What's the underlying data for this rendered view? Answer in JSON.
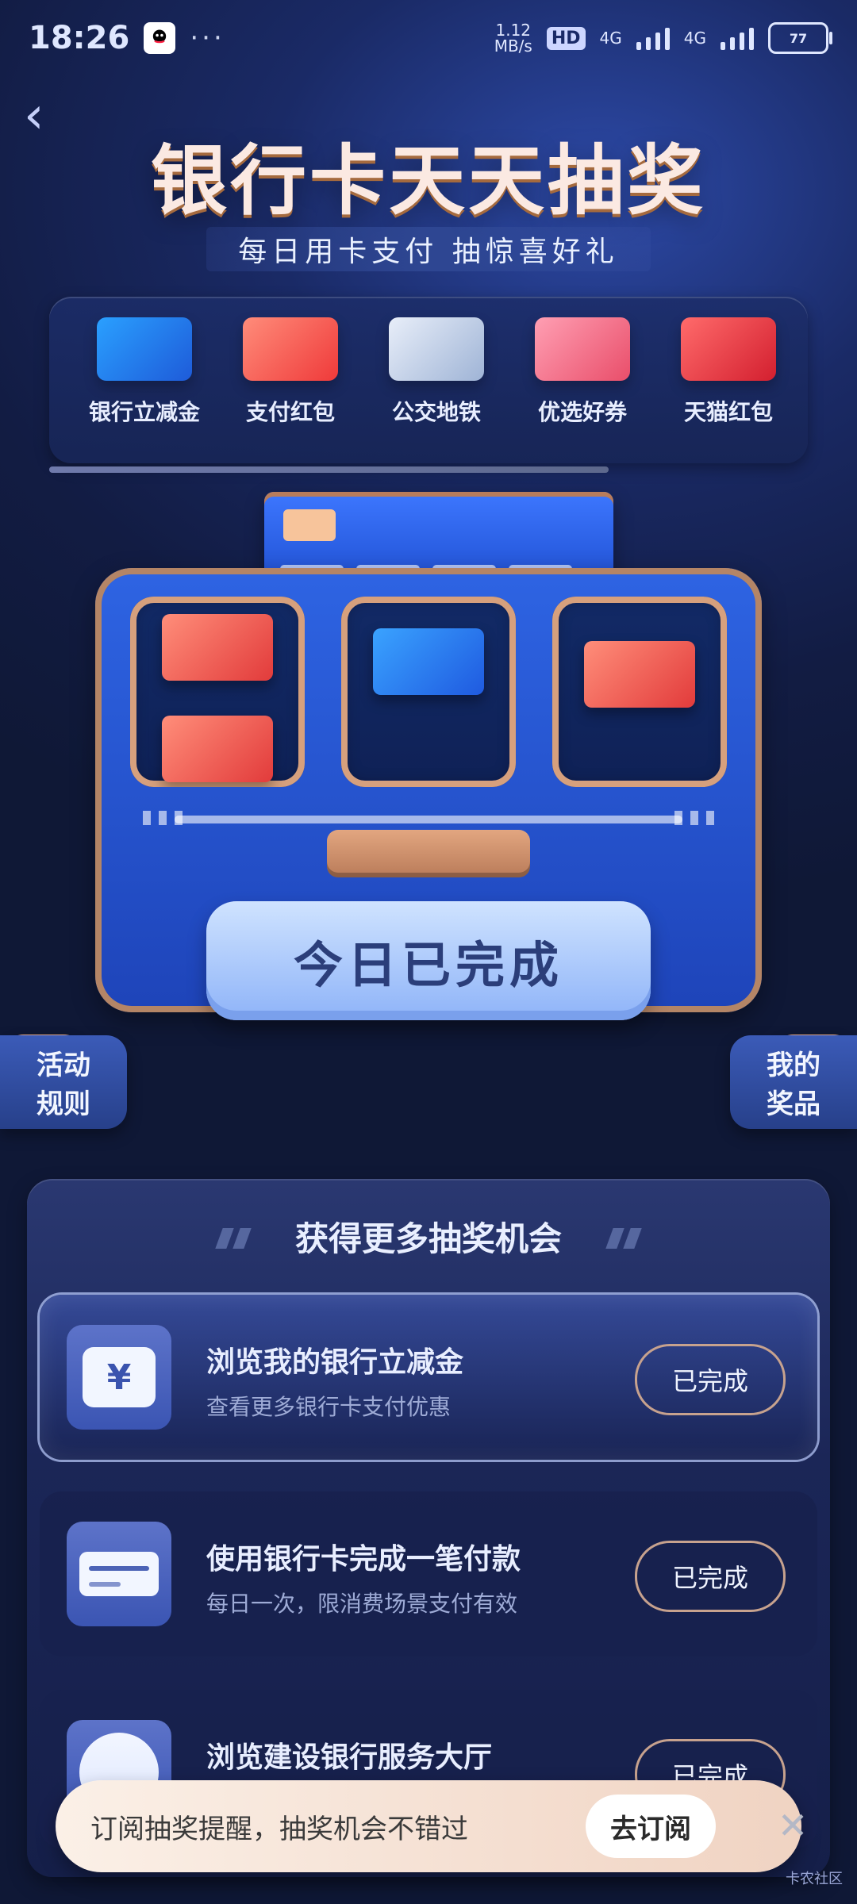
{
  "status_bar": {
    "time": "18:26",
    "dots": "···",
    "net_speed_value": "1.12",
    "net_speed_unit": "MB/s",
    "hd_label": "HD",
    "sig_label_1": "4G",
    "sig_label_2": "4G",
    "battery_level": "77"
  },
  "header": {
    "title": "银行卡天天抽奖",
    "subtitle": "每日用卡支付 抽惊喜好礼"
  },
  "prizes": [
    {
      "label": "银行立减金"
    },
    {
      "label": "支付红包"
    },
    {
      "label": "公交地铁"
    },
    {
      "label": "优选好券"
    },
    {
      "label": "天猫红包"
    }
  ],
  "machine": {
    "done_label": "今日已完成"
  },
  "side": {
    "rules": "活动\n规则",
    "my_prizes": "我的\n奖品"
  },
  "panel": {
    "title": "获得更多抽奖机会",
    "tasks": [
      {
        "title": "浏览我的银行立减金",
        "desc": "查看更多银行卡支付优惠",
        "btn": "已完成",
        "icon": "yen-ticket-icon"
      },
      {
        "title": "使用银行卡完成一笔付款",
        "desc": "每日一次，限消费场景支付有效",
        "btn": "已完成",
        "icon": "bank-card-icon"
      },
      {
        "title": "浏览建设银行服务大厅",
        "desc": "",
        "btn": "已完成",
        "icon": "ccb-logo-icon"
      }
    ]
  },
  "toast": {
    "text": "订阅抽奖提醒，抽奖机会不错过",
    "button": "去订阅",
    "close": "✕"
  },
  "watermark": "卡农社区",
  "colors": {
    "bg_dark": "#121c43",
    "bg_mid": "#1a2a66",
    "accent_blue": "#2e64e3",
    "copper": "#b48566",
    "button_border": "#c7a28e"
  }
}
